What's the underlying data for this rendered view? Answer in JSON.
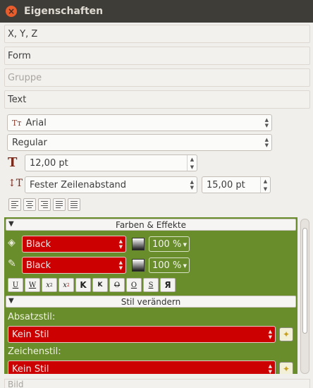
{
  "window": {
    "title": "Eigenschaften",
    "close_symbol": "×"
  },
  "sections": {
    "xyz": "X, Y, Z",
    "form": "Form",
    "gruppe": "Gruppe",
    "text": "Text",
    "bild": "Bild"
  },
  "text_props": {
    "font_family": "Arial",
    "font_style": "Regular",
    "font_size": "12,00 pt",
    "line_spacing_mode": "Fester Zeilenabstand",
    "line_spacing_value": "15,00 pt",
    "alignments": [
      "align-left",
      "align-center",
      "align-right",
      "justify",
      "force-justify"
    ]
  },
  "farben_effekte": {
    "header": "Farben & Effekte",
    "fill_color": "Black",
    "fill_shade": "100 %",
    "stroke_color": "Black",
    "stroke_shade": "100 %",
    "effects": [
      "U",
      "W",
      "x",
      "x",
      "K",
      "K",
      "O",
      "O",
      "S",
      "Я"
    ]
  },
  "stil": {
    "header": "Stil verändern",
    "absatzstil_label": "Absatzstil:",
    "absatzstil_value": "Kein Stil",
    "zeichenstil_label": "Zeichenstil:",
    "zeichenstil_value": "Kein Stil"
  },
  "colors": {
    "panel_green": "#6a8d2b",
    "combo_red": "#cc0000",
    "titlebar": "#3e3d38",
    "close_button": "#e95d2d"
  }
}
